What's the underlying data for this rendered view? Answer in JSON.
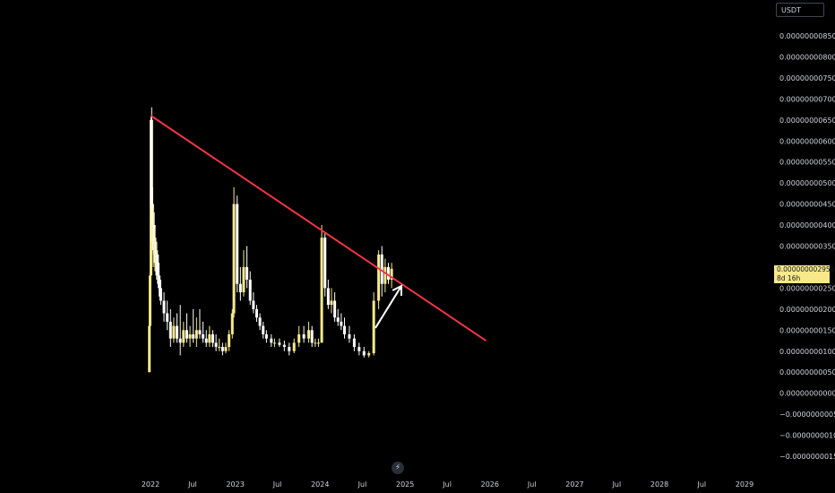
{
  "currency_button": "USDT",
  "price_tag": {
    "price": "0.0000000029596",
    "countdown": "8d 16h"
  },
  "axis": {
    "yticks": [
      {
        "label": "0.0000000085000",
        "value": 8.5e-09
      },
      {
        "label": "0.0000000080000",
        "value": 8e-09
      },
      {
        "label": "0.0000000075000",
        "value": 7.5e-09
      },
      {
        "label": "0.0000000070000",
        "value": 7e-09
      },
      {
        "label": "0.0000000065000",
        "value": 6.5e-09
      },
      {
        "label": "0.0000000060000",
        "value": 6e-09
      },
      {
        "label": "0.0000000055000",
        "value": 5.5e-09
      },
      {
        "label": "0.0000000050000",
        "value": 5e-09
      },
      {
        "label": "0.0000000045000",
        "value": 4.5e-09
      },
      {
        "label": "0.0000000040000",
        "value": 4e-09
      },
      {
        "label": "0.0000000035000",
        "value": 3.5e-09
      },
      {
        "label": "0.0000000025000",
        "value": 2.5e-09
      },
      {
        "label": "0.0000000020000",
        "value": 2e-09
      },
      {
        "label": "0.0000000015000",
        "value": 1.5e-09
      },
      {
        "label": "0.0000000010000",
        "value": 1e-09
      },
      {
        "label": "0.0000000005000",
        "value": 5e-10
      },
      {
        "label": "0.0000000000000",
        "value": 0
      },
      {
        "label": "−0.0000000005000",
        "value": -5e-10
      },
      {
        "label": "−0.0000000010000",
        "value": -1e-09
      },
      {
        "label": "−0.0000000015000",
        "value": -1.5e-09
      }
    ],
    "xticks": [
      {
        "label": "2022",
        "date": "2022-01"
      },
      {
        "label": "Jul",
        "date": "2022-07"
      },
      {
        "label": "2023",
        "date": "2023-01"
      },
      {
        "label": "Jul",
        "date": "2023-07"
      },
      {
        "label": "2024",
        "date": "2024-01"
      },
      {
        "label": "Jul",
        "date": "2024-07"
      },
      {
        "label": "2025",
        "date": "2025-01"
      },
      {
        "label": "Jul",
        "date": "2025-07"
      },
      {
        "label": "2026",
        "date": "2026-01"
      },
      {
        "label": "Jul",
        "date": "2026-07"
      },
      {
        "label": "2027",
        "date": "2027-01"
      },
      {
        "label": "Jul",
        "date": "2027-07"
      },
      {
        "label": "2028",
        "date": "2028-01"
      },
      {
        "label": "Jul",
        "date": "2028-07"
      },
      {
        "label": "2029",
        "date": "2029-01"
      }
    ]
  },
  "colors": {
    "background": "#000000",
    "candle_up": "#f7e98a",
    "candle_down": "#ffffff",
    "trendline": "#f23645",
    "arrow": "#ffffff",
    "price_tag": "#f7e98a"
  },
  "chart_data": {
    "type": "candlestick",
    "title": "",
    "xlabel": "",
    "ylabel": "",
    "ylim": [
      -1.7e-09,
      8.9e-09
    ],
    "series": [
      {
        "candles": [
          [
            "2021-12-27",
            5e-10,
            2e-09,
            5e-10,
            1.6e-09
          ],
          [
            "2021-12-30",
            1.6e-09,
            3.4e-09,
            1.2e-09,
            2.8e-09
          ],
          [
            "2022-01-03",
            2.8e-09,
            6.6e-09,
            2.6e-09,
            6.5e-09
          ],
          [
            "2022-01-06",
            6.5e-09,
            6.8e-09,
            4.2e-09,
            4.5e-09
          ],
          [
            "2022-01-10",
            4.5e-09,
            4.9e-09,
            3.4e-09,
            3.6e-09
          ],
          [
            "2022-01-13",
            3.6e-09,
            4.4e-09,
            3e-09,
            4e-09
          ],
          [
            "2022-01-17",
            4e-09,
            4.3e-09,
            3.1e-09,
            3.3e-09
          ],
          [
            "2022-01-20",
            3.3e-09,
            3.9e-09,
            2.9e-09,
            3.6e-09
          ],
          [
            "2022-01-24",
            3.6e-09,
            3.7e-09,
            2.8e-09,
            3e-09
          ],
          [
            "2022-01-27",
            3e-09,
            3.6e-09,
            2.7e-09,
            3.3e-09
          ],
          [
            "2022-01-31",
            3.3e-09,
            3.4e-09,
            2.6e-09,
            2.8e-09
          ],
          [
            "2022-02-07",
            2.8e-09,
            3.1e-09,
            2.3e-09,
            2.5e-09
          ],
          [
            "2022-02-14",
            2.5e-09,
            2.7e-09,
            2.1e-09,
            2.2e-09
          ],
          [
            "2022-02-28",
            2.2e-09,
            2.4e-09,
            1.7e-09,
            1.9e-09
          ],
          [
            "2022-03-14",
            1.9e-09,
            2.2e-09,
            1.5e-09,
            1.7e-09
          ],
          [
            "2022-03-28",
            1.7e-09,
            2e-09,
            1.1e-09,
            1.3e-09
          ],
          [
            "2022-04-11",
            1.3e-09,
            1.8e-09,
            1.2e-09,
            1.6e-09
          ],
          [
            "2022-04-25",
            1.6e-09,
            1.9e-09,
            1.2e-09,
            1.3e-09
          ],
          [
            "2022-05-09",
            1.3e-09,
            2.1e-09,
            9e-10,
            1.2e-09
          ],
          [
            "2022-05-23",
            1.2e-09,
            1.7e-09,
            1.1e-09,
            1.5e-09
          ],
          [
            "2022-06-06",
            1.5e-09,
            1.9e-09,
            1.2e-09,
            1.3e-09
          ],
          [
            "2022-06-20",
            1.3e-09,
            1.6e-09,
            1.1e-09,
            1.4e-09
          ],
          [
            "2022-07-04",
            1.4e-09,
            2e-09,
            1.2e-09,
            1.3e-09
          ],
          [
            "2022-07-18",
            1.3e-09,
            1.8e-09,
            1.1e-09,
            1.5e-09
          ],
          [
            "2022-08-01",
            1.5e-09,
            2e-09,
            1.3e-09,
            1.4e-09
          ],
          [
            "2022-08-15",
            1.4e-09,
            1.7e-09,
            1.2e-09,
            1.3e-09
          ],
          [
            "2022-08-29",
            1.3e-09,
            1.5e-09,
            1.1e-09,
            1.2e-09
          ],
          [
            "2022-09-12",
            1.2e-09,
            1.6e-09,
            1.1e-09,
            1.4e-09
          ],
          [
            "2022-09-26",
            1.4e-09,
            1.5e-09,
            1.1e-09,
            1.2e-09
          ],
          [
            "2022-10-10",
            1.2e-09,
            1.4e-09,
            1e-09,
            1.1e-09
          ],
          [
            "2022-10-24",
            1.1e-09,
            1.3e-09,
            1e-09,
            1.1e-09
          ],
          [
            "2022-11-07",
            1.1e-09,
            1.2e-09,
            9e-10,
            1e-09
          ],
          [
            "2022-11-21",
            1e-09,
            1.2e-09,
            9.5e-10,
            1.1e-09
          ],
          [
            "2022-12-05",
            1.1e-09,
            1.5e-09,
            1e-09,
            1.4e-09
          ],
          [
            "2022-12-19",
            1.4e-09,
            2e-09,
            1.3e-09,
            1.9e-09
          ],
          [
            "2022-12-26",
            1.9e-09,
            4.9e-09,
            1.8e-09,
            4.5e-09
          ],
          [
            "2023-01-09",
            4.5e-09,
            4.7e-09,
            2.4e-09,
            2.6e-09
          ],
          [
            "2023-01-23",
            2.6e-09,
            3e-09,
            2.2e-09,
            2.4e-09
          ],
          [
            "2023-02-06",
            2.4e-09,
            3.4e-09,
            2.3e-09,
            3e-09
          ],
          [
            "2023-02-20",
            3e-09,
            3.5e-09,
            2.5e-09,
            2.7e-09
          ],
          [
            "2023-03-06",
            2.7e-09,
            2.9e-09,
            2.1e-09,
            2.2e-09
          ],
          [
            "2023-03-20",
            2.2e-09,
            2.4e-09,
            1.9e-09,
            2e-09
          ],
          [
            "2023-04-03",
            2e-09,
            2.1e-09,
            1.7e-09,
            1.8e-09
          ],
          [
            "2023-04-17",
            1.8e-09,
            1.9e-09,
            1.5e-09,
            1.6e-09
          ],
          [
            "2023-05-01",
            1.6e-09,
            1.7e-09,
            1.3e-09,
            1.4e-09
          ],
          [
            "2023-05-15",
            1.4e-09,
            1.5e-09,
            1.2e-09,
            1.3e-09
          ],
          [
            "2023-06-05",
            1.3e-09,
            1.4e-09,
            1.1e-09,
            1.2e-09
          ],
          [
            "2023-06-19",
            1.2e-09,
            1.3e-09,
            1.1e-09,
            1.2e-09
          ],
          [
            "2023-07-10",
            1.2e-09,
            1.3e-09,
            1.1e-09,
            1.15e-09
          ],
          [
            "2023-07-31",
            1.15e-09,
            1.25e-09,
            1e-09,
            1.1e-09
          ],
          [
            "2023-08-21",
            1.1e-09,
            1.2e-09,
            9e-10,
            1e-09
          ],
          [
            "2023-09-11",
            1e-09,
            1.3e-09,
            9.5e-10,
            1.2e-09
          ],
          [
            "2023-10-02",
            1.2e-09,
            1.6e-09,
            1.1e-09,
            1.4e-09
          ],
          [
            "2023-10-23",
            1.4e-09,
            1.6e-09,
            1.2e-09,
            1.3e-09
          ],
          [
            "2023-11-13",
            1.3e-09,
            1.7e-09,
            1.2e-09,
            1.5e-09
          ],
          [
            "2023-11-27",
            1.5e-09,
            1.6e-09,
            1.1e-09,
            1.2e-09
          ],
          [
            "2023-12-11",
            1.2e-09,
            1.3e-09,
            1.1e-09,
            1.2e-09
          ],
          [
            "2023-12-25",
            1.2e-09,
            1.3e-09,
            1.1e-09,
            1.2e-09
          ],
          [
            "2024-01-08",
            1.2e-09,
            4e-09,
            1.2e-09,
            3.7e-09
          ],
          [
            "2024-01-22",
            3.7e-09,
            3.8e-09,
            2.3e-09,
            2.5e-09
          ],
          [
            "2024-02-05",
            2.5e-09,
            2.7e-09,
            2e-09,
            2.1e-09
          ],
          [
            "2024-02-19",
            2.1e-09,
            2.5e-09,
            1.9e-09,
            2.2e-09
          ],
          [
            "2024-03-04",
            2.2e-09,
            2.4e-09,
            1.7e-09,
            1.8e-09
          ],
          [
            "2024-03-18",
            1.8e-09,
            2e-09,
            1.6e-09,
            1.7e-09
          ],
          [
            "2024-04-01",
            1.7e-09,
            1.9e-09,
            1.5e-09,
            1.6e-09
          ],
          [
            "2024-04-15",
            1.6e-09,
            1.8e-09,
            1.3e-09,
            1.4e-09
          ],
          [
            "2024-05-06",
            1.4e-09,
            1.6e-09,
            1.2e-09,
            1.3e-09
          ],
          [
            "2024-05-27",
            1.3e-09,
            1.4e-09,
            1e-09,
            1.1e-09
          ],
          [
            "2024-06-17",
            1.1e-09,
            1.2e-09,
            9e-10,
            1e-09
          ],
          [
            "2024-07-08",
            1e-09,
            1.1e-09,
            8.5e-10,
            9e-10
          ],
          [
            "2024-07-29",
            9e-10,
            1e-09,
            8.5e-10,
            9.5e-10
          ],
          [
            "2024-08-19",
            9.5e-10,
            2.4e-09,
            9e-10,
            2.2e-09
          ],
          [
            "2024-09-09",
            2.2e-09,
            3.4e-09,
            2e-09,
            3.3e-09
          ],
          [
            "2024-09-23",
            3.3e-09,
            3.5e-09,
            2.3e-09,
            2.6e-09
          ],
          [
            "2024-10-07",
            2.6e-09,
            3.2e-09,
            2.4e-09,
            3e-09
          ],
          [
            "2024-10-21",
            3e-09,
            3.1e-09,
            2.6e-09,
            2.7e-09
          ],
          [
            "2024-11-04",
            2.7e-09,
            3.1e-09,
            2.5e-09,
            2.96e-09
          ]
        ]
      }
    ],
    "annotations": {
      "trendline": {
        "start": [
          "2022-01-03",
          6.6e-09
        ],
        "end": [
          "2025-12-15",
          1.25e-09
        ]
      },
      "arrow": {
        "start": [
          "2024-08-26",
          1.55e-09
        ],
        "end": [
          "2024-12-16",
          2.55e-09
        ]
      }
    }
  }
}
